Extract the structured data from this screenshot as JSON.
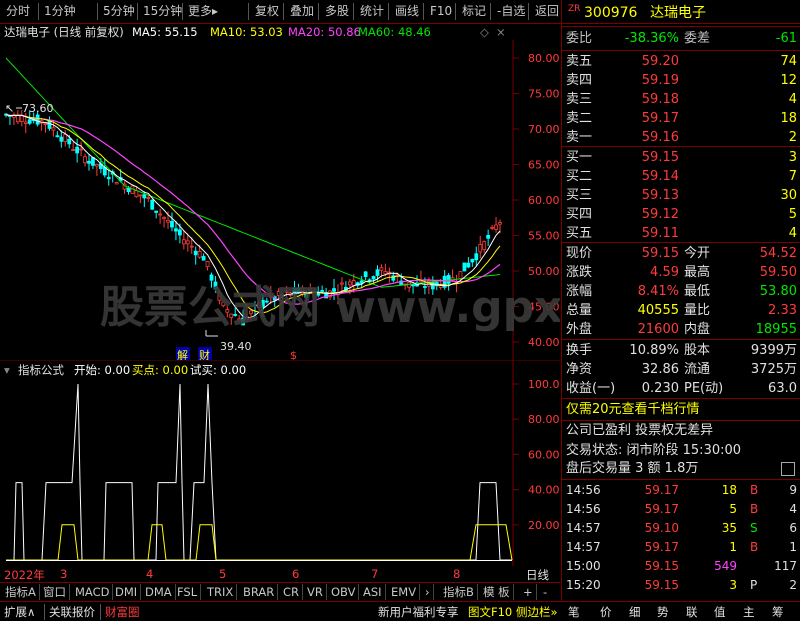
{
  "toolbar": {
    "left_items": [
      "分时",
      "1分钟",
      "5分钟",
      "15分钟",
      "更多"
    ],
    "right_items": [
      "复权",
      "叠加",
      "多股",
      "统计",
      "画线",
      "F10",
      "标记",
      "-自选",
      "返回"
    ]
  },
  "chart_header": {
    "title": "达瑞电子 (日线 前复权)",
    "ma5": "MA5: 55.15",
    "ma10": "MA10: 53.03",
    "ma20": "MA20: 50.86",
    "ma60": "MA60: 48.46"
  },
  "price_axis": [
    "80.00",
    "75.00",
    "70.00",
    "65.00",
    "60.00",
    "55.00",
    "50.00",
    "45.00",
    "40.00"
  ],
  "annotations": {
    "high": "73.60",
    "low": "39.40",
    "marker1": "解",
    "marker2": "财",
    "marker3": "$"
  },
  "indicator_header": {
    "name": "指标公式",
    "start": "开始: 0.00",
    "buy": "买点: 0.00",
    "trial": "试买: 0.00"
  },
  "indicator_axis": [
    "100.0",
    "80.00",
    "60.00",
    "40.00",
    "20.00"
  ],
  "date_axis": {
    "year": "2022年",
    "months": [
      "3",
      "4",
      "5",
      "6",
      "7",
      "8"
    ],
    "period": "日线"
  },
  "bottom_tabs": [
    "指标A",
    "窗口",
    "MACD",
    "DMI",
    "DMA",
    "FSL",
    "TRIX",
    "BRAR",
    "CR",
    "VR",
    "OBV",
    "ASI",
    "EMV",
    "指标B",
    "模 板",
    "+",
    "-"
  ],
  "statusbar": {
    "left": [
      "扩展∧",
      "关联报价",
      "财富圈"
    ],
    "right": [
      "新用户福利专享",
      "图文F10",
      "侧边栏"
    ],
    "icons": [
      "笔",
      "价",
      "细",
      "势",
      "联",
      "值",
      "主",
      "筹"
    ]
  },
  "watermark": "股票公式网 www.gpxs.com",
  "stock": {
    "prefix": "ZR",
    "code": "300976",
    "name": "达瑞电子"
  },
  "ratio": {
    "label1": "委比",
    "value1": "-38.36%",
    "label2": "委差",
    "value2": "-61"
  },
  "asks": [
    {
      "label": "卖五",
      "price": "59.20",
      "vol": "74"
    },
    {
      "label": "卖四",
      "price": "59.19",
      "vol": "12"
    },
    {
      "label": "卖三",
      "price": "59.18",
      "vol": "4"
    },
    {
      "label": "卖二",
      "price": "59.17",
      "vol": "18"
    },
    {
      "label": "卖一",
      "price": "59.16",
      "vol": "2"
    }
  ],
  "bids": [
    {
      "label": "买一",
      "price": "59.15",
      "vol": "3"
    },
    {
      "label": "买二",
      "price": "59.14",
      "vol": "7"
    },
    {
      "label": "买三",
      "price": "59.13",
      "vol": "30"
    },
    {
      "label": "买四",
      "price": "59.12",
      "vol": "5"
    },
    {
      "label": "买五",
      "price": "59.11",
      "vol": "4"
    }
  ],
  "quote": [
    {
      "l1": "现价",
      "v1": "59.15",
      "l2": "今开",
      "v2": "54.52"
    },
    {
      "l1": "涨跌",
      "v1": "4.59",
      "l2": "最高",
      "v2": "59.50"
    },
    {
      "l1": "涨幅",
      "v1": "8.41%",
      "l2": "最低",
      "v2": "53.80"
    },
    {
      "l1": "总量",
      "v1": "40555",
      "l2": "量比",
      "v2": "2.33"
    },
    {
      "l1": "外盘",
      "v1": "21600",
      "l2": "内盘",
      "v2": "18955"
    }
  ],
  "fundamentals": [
    {
      "l1": "换手",
      "v1": "10.89%",
      "l2": "股本",
      "v2": "9399万"
    },
    {
      "l1": "净资",
      "v1": "32.86",
      "l2": "流通",
      "v2": "3725万"
    },
    {
      "l1": "收益(一)",
      "v1": "0.230",
      "l2": "PE(动)",
      "v2": "63.0"
    }
  ],
  "info": {
    "promo": "仅需20元查看千档行情",
    "profit": "公司已盈利 投票权无差异",
    "status": "交易状态: 闭市阶段 15:30:00",
    "after": "盘后交易量 3 额 1.8万"
  },
  "ticks": [
    {
      "t": "14:56",
      "p": "59.17",
      "v": "18",
      "s": "B",
      "n": "9"
    },
    {
      "t": "14:56",
      "p": "59.17",
      "v": "5",
      "s": "B",
      "n": "4"
    },
    {
      "t": "14:57",
      "p": "59.10",
      "v": "35",
      "s": "S",
      "n": "6"
    },
    {
      "t": "14:57",
      "p": "59.17",
      "v": "1",
      "s": "B",
      "n": "1"
    },
    {
      "t": "15:00",
      "p": "59.15",
      "v": "549",
      "s": "",
      "n": "117"
    },
    {
      "t": "15:20",
      "p": "59.15",
      "v": "3",
      "s": "P",
      "n": "2"
    }
  ],
  "colors": {
    "up": "#ff3b3b",
    "down": "#00e600",
    "ma5": "#ffffff",
    "ma10": "#ffff00",
    "ma20": "#ff44ff",
    "ma60": "#00e600",
    "border": "#7a0000"
  }
}
